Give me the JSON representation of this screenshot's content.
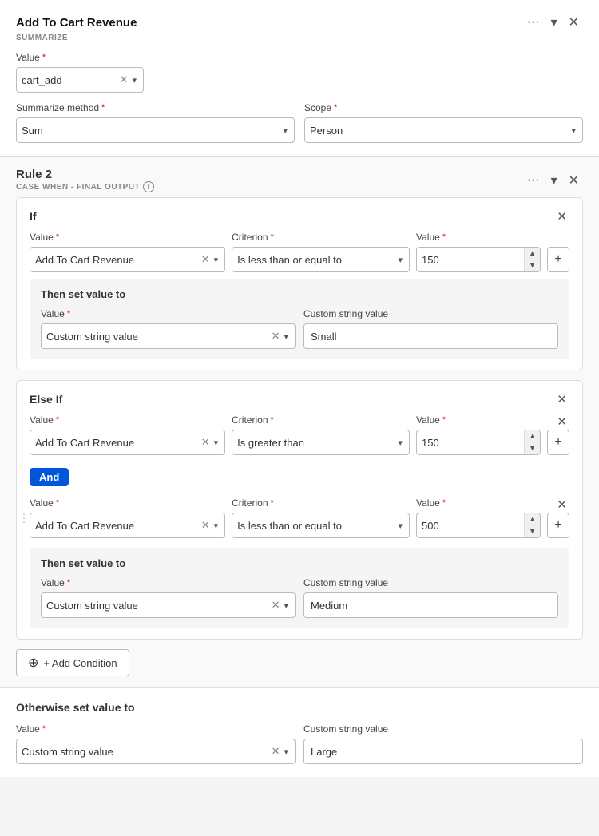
{
  "summarize_panel": {
    "title": "Add To Cart Revenue",
    "subtitle": "SUMMARIZE",
    "value_label": "Value",
    "value": "cart_add",
    "summarize_method_label": "Summarize method",
    "summarize_method_value": "Sum",
    "scope_label": "Scope",
    "scope_value": "Person"
  },
  "rule2": {
    "title": "Rule 2",
    "subtitle": "CASE WHEN - FINAL OUTPUT",
    "if_card": {
      "title": "If",
      "value_label": "Value",
      "value": "Add To Cart Revenue",
      "criterion_label": "Criterion",
      "criterion": "Is less than or equal to",
      "val_label": "Value",
      "val": "150",
      "then_title": "Then set value to",
      "then_value_label": "Value",
      "then_value": "Custom string value",
      "then_custom_label": "Custom string value",
      "then_custom": "Small"
    },
    "else_if_card": {
      "title": "Else If",
      "row1": {
        "value_label": "Value",
        "value": "Add To Cart Revenue",
        "criterion_label": "Criterion",
        "criterion": "Is greater than",
        "val_label": "Value",
        "val": "150"
      },
      "and_btn": "And",
      "row2": {
        "value_label": "Value",
        "value": "Add To Cart Revenue",
        "criterion_label": "Criterion",
        "criterion": "Is less than or equal to",
        "val_label": "Value",
        "val": "500"
      },
      "then_title": "Then set value to",
      "then_value_label": "Value",
      "then_value": "Custom string value",
      "then_custom_label": "Custom string value",
      "then_custom": "Medium"
    },
    "add_condition_label": "+ Add Condition",
    "otherwise_title": "Otherwise set value to",
    "otherwise_value_label": "Value",
    "otherwise_value": "Custom string value",
    "otherwise_custom_label": "Custom string value",
    "otherwise_custom": "Large"
  },
  "icons": {
    "more": "···",
    "chevron_down": "▾",
    "close": "✕",
    "clear": "✕",
    "up": "▲",
    "down": "▼",
    "drag": "⋮⋮",
    "plus": "+",
    "info": "i"
  }
}
